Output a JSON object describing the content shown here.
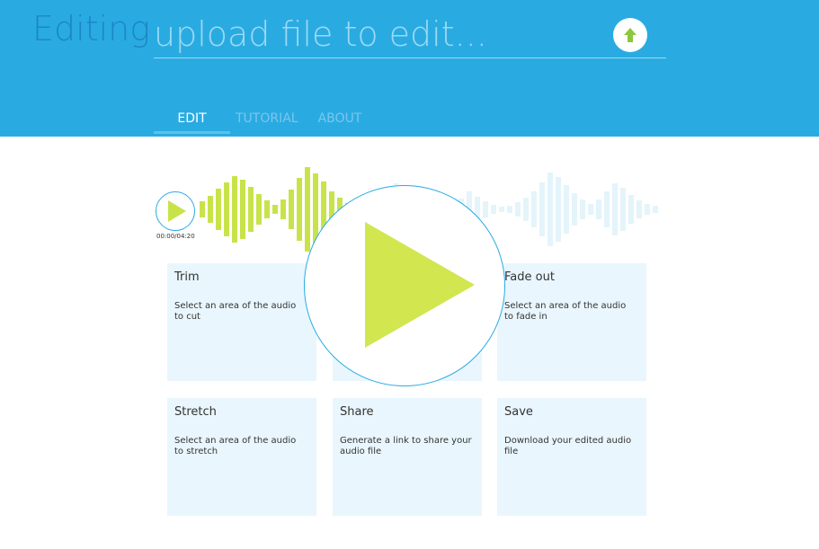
{
  "header": {
    "title": "Editing",
    "file_placeholder": "upload file to edit...",
    "upload_icon": "arrow-up-icon",
    "accent_color": "#29abe2",
    "upload_icon_color": "#8dc63f"
  },
  "tabs": [
    {
      "label": "EDIT",
      "active": true
    },
    {
      "label": "TUTORIAL",
      "active": false
    },
    {
      "label": "ABOUT",
      "active": false
    }
  ],
  "player": {
    "time": "00:00/04:20",
    "play_color": "#c8e34a"
  },
  "tools": [
    {
      "title": "Trim",
      "description": "Select an area of the audio to cut"
    },
    {
      "title": "",
      "description": ""
    },
    {
      "title": "Fade out",
      "description": "Select an area of the audio to fade in"
    },
    {
      "title": "Stretch",
      "description": "Select an area of the audio to stretch"
    },
    {
      "title": "Share",
      "description": "Generate a link to share your audio file"
    },
    {
      "title": "Save",
      "description": "Download your edited audio file"
    }
  ]
}
